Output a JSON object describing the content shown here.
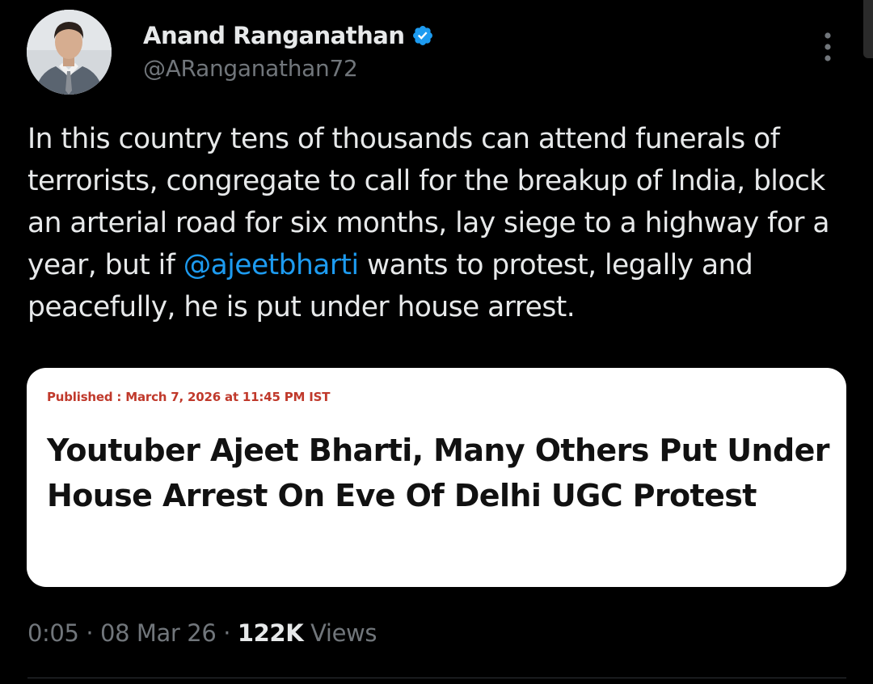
{
  "author": {
    "display_name": "Anand Ranganathan",
    "handle": "@ARanganathan72",
    "verified": true
  },
  "tweet": {
    "text_before_mention": "In this country tens of thousands can attend funerals of terrorists, congregate to call for the breakup of India, block an arterial road for six months, lay siege to a highway for a year, but if ",
    "mention": "@ajeetbharti",
    "text_after_mention": " wants to protest, legally and peacefully, he is put under house arrest."
  },
  "card": {
    "published": "Published : March 7, 2026 at 11:45 PM IST",
    "headline": "Youtuber Ajeet Bharti, Many Others Put Under House Arrest On Eve Of Delhi UGC Protest"
  },
  "meta": {
    "time": "0:05",
    "separator": "·",
    "date": "08 Mar 26",
    "views_count": "122K",
    "views_label": "Views"
  },
  "icons": {
    "verified": "verified-badge-icon",
    "more": "more-options-icon"
  },
  "colors": {
    "background": "#000000",
    "text_primary": "#e7e9ea",
    "text_secondary": "#71767b",
    "link": "#1d9bf0",
    "verified": "#1d9bf0",
    "card_background": "#ffffff",
    "published_red": "#c0392b"
  }
}
